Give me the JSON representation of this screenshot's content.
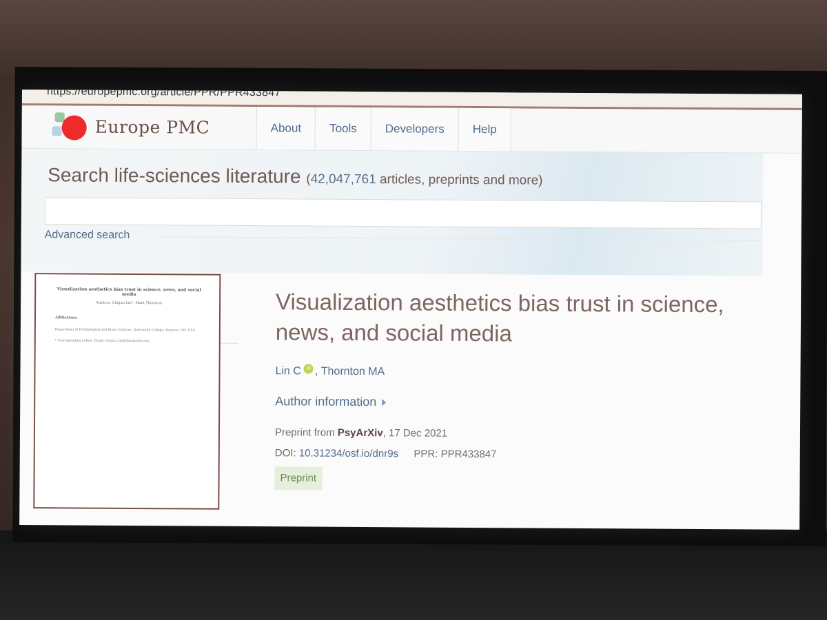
{
  "browser": {
    "url": "https://europepmc.org/article/PPR/PPR433847"
  },
  "header": {
    "logo_text": "Europe PMC",
    "nav": [
      "About",
      "Tools",
      "Developers",
      "Help"
    ]
  },
  "search": {
    "title": "Search life-sciences literature",
    "count_open": "(",
    "count_number": "42,047,761",
    "count_rest": " articles, preprints and more)",
    "input_value": "",
    "advanced_label": "Advanced search"
  },
  "thumbnail": {
    "title": "Visualization aesthetics bias trust in science, news, and social media",
    "authors": "Authors: Chujun Lin*, Mark Thornton",
    "affiliations_heading": "Affiliations:",
    "affiliation": "Department of Psychological and Brain Sciences, Dartmouth College, Hanover, NH, USA.",
    "corresponding": "* Corresponding author. Email: Chujun.Lin@Dartmouth.edu"
  },
  "article": {
    "title": "Visualization aesthetics bias trust in science, news, and social media",
    "author1": "Lin C",
    "orcid_label": "iD",
    "author_sep": ",",
    "author2": "Thornton MA",
    "author_info_label": "Author information",
    "preprint_from_label": "Preprint from",
    "source": "PsyArXiv",
    "date": ", 17 Dec 2021",
    "doi_label": "DOI:",
    "doi": "10.31234/osf.io/dnr9s",
    "ppr_label": "PPR:",
    "ppr": "PPR433847",
    "badge": "Preprint"
  },
  "colors": {
    "logo_dot": "#ee2b2b",
    "link": "#4f6b8c",
    "title": "#7d6560",
    "badge_bg": "#e5efd9"
  }
}
